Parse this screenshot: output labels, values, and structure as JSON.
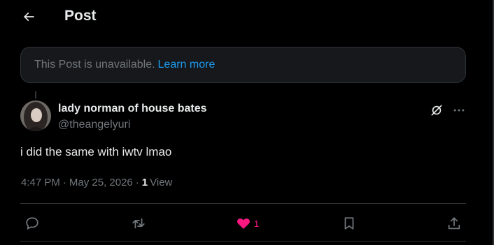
{
  "header": {
    "title": "Post",
    "back_icon": "arrow-left-icon"
  },
  "unavailable_notice": {
    "text": "This Post is unavailable.",
    "link": "Learn more"
  },
  "post": {
    "author_name": "lady norman of house bates",
    "handle": "@theangelyuri",
    "text": "i did the same with iwtv lmao",
    "time": "4:47 PM",
    "separator": "·",
    "date": "May 25, 2026",
    "views_count": "1",
    "views_label": "View"
  },
  "actions": {
    "reply_icon": "reply-bubble-icon",
    "repost_icon": "repost-icon",
    "like_icon": "heart-icon",
    "like_count": "1",
    "bookmark_icon": "bookmark-icon",
    "share_icon": "share-icon"
  },
  "colors": {
    "background": "#000000",
    "text": "#e7e9ea",
    "muted": "#71767b",
    "link": "#1d9bf0",
    "like": "#f91880",
    "border": "#2f3336"
  }
}
